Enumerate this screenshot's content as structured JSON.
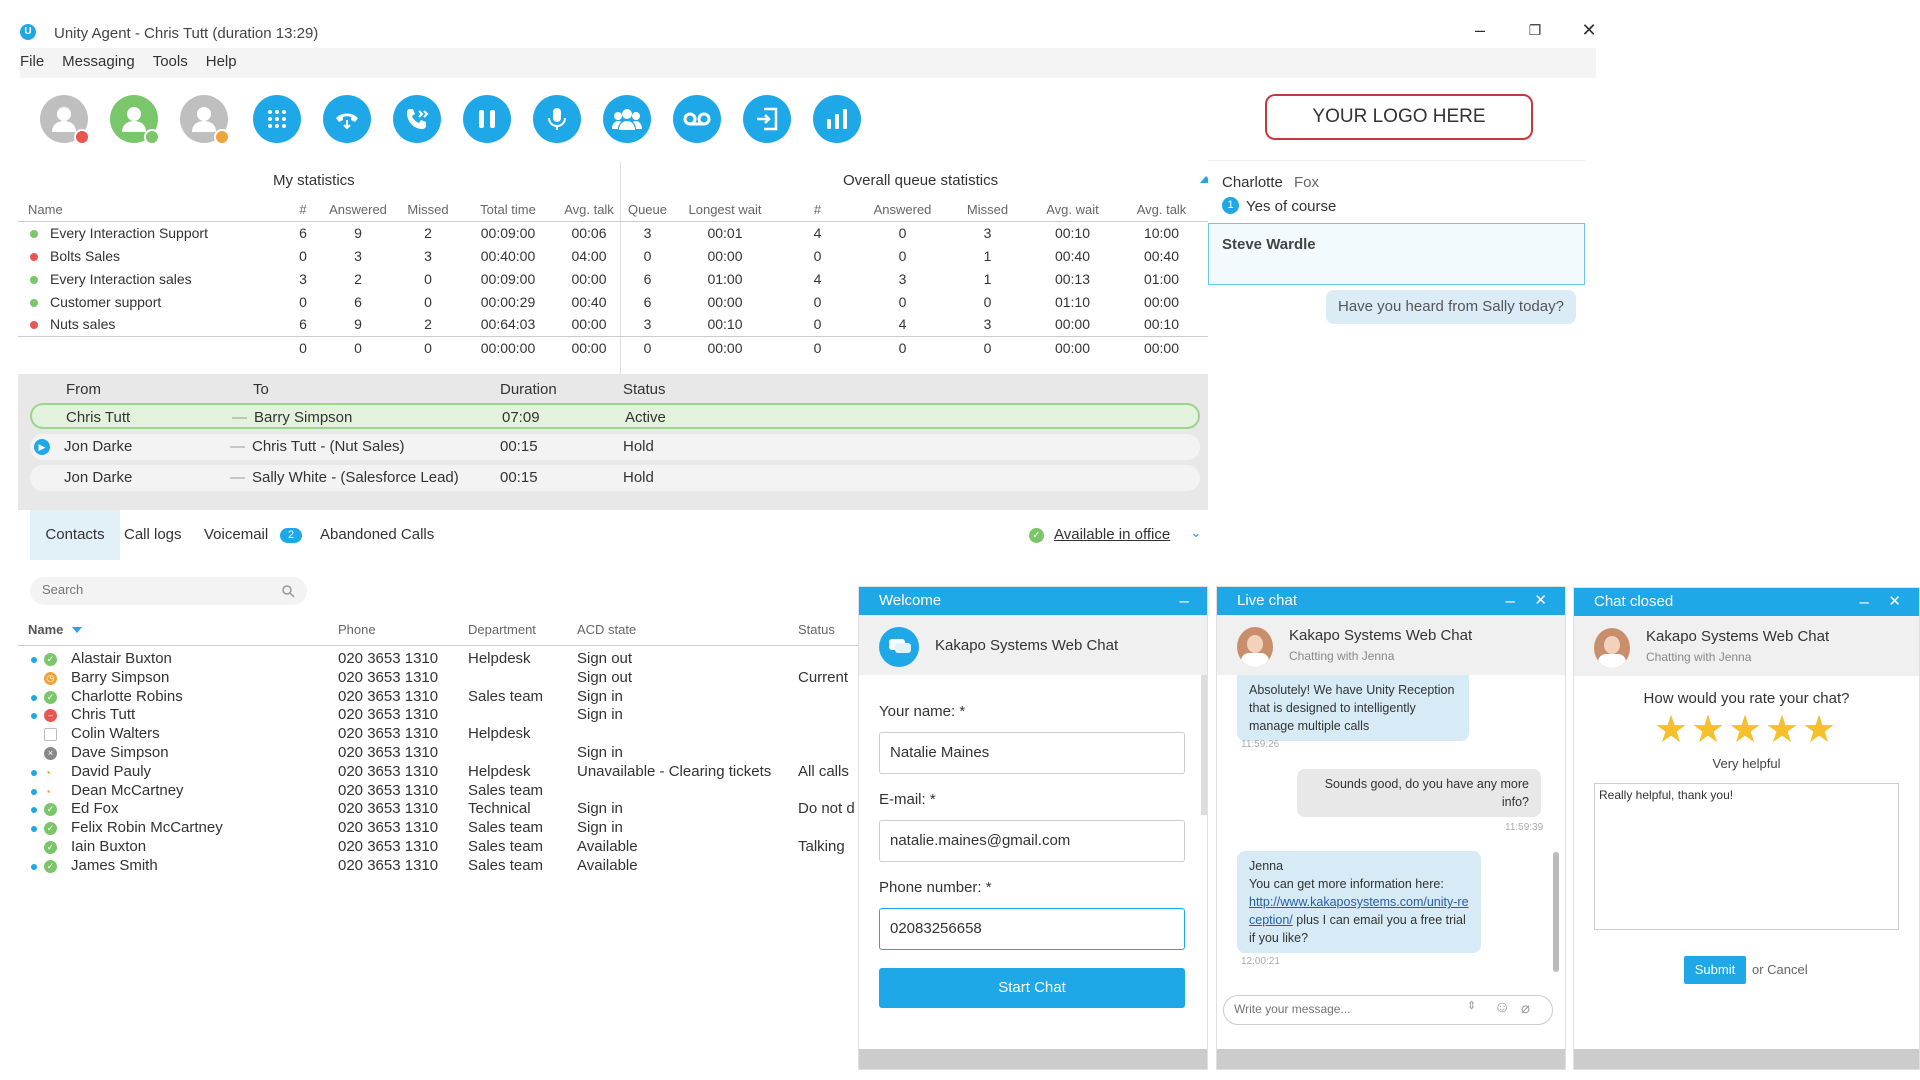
{
  "window": {
    "title": "Unity Agent - Chris Tutt  (duration 13:29)",
    "min": "–",
    "max": "❐",
    "close": "✕"
  },
  "menu": [
    "File",
    "Messaging",
    "Tools",
    "Help"
  ],
  "logo": "YOUR LOGO HERE",
  "stats": {
    "my_title": "My statistics",
    "queue_title": "Overall queue statistics",
    "headers": [
      "Name",
      "#",
      "Answered",
      "Missed",
      "Total time",
      "Avg. talk",
      "Queue",
      "Longest wait",
      "#",
      "Answered",
      "Missed",
      "Avg. wait",
      "Avg. talk"
    ],
    "rows": [
      {
        "status": "#7ac66a",
        "name": "Every Interaction Support",
        "c": [
          "6",
          "9",
          "2",
          "00:09:00",
          "00:06",
          "3",
          "00:01",
          "4",
          "0",
          "3",
          "00:10",
          "10:00"
        ]
      },
      {
        "status": "#e8564f",
        "name": "Bolts Sales",
        "c": [
          "0",
          "3",
          "3",
          "00:40:00",
          "04:00",
          "0",
          "00:00",
          "0",
          "0",
          "1",
          "00:40",
          "00:40"
        ]
      },
      {
        "status": "#7ac66a",
        "name": "Every Interaction sales",
        "c": [
          "3",
          "2",
          "0",
          "00:09:00",
          "00:00",
          "6",
          "01:00",
          "4",
          "3",
          "1",
          "00:13",
          "01:00"
        ]
      },
      {
        "status": "#7ac66a",
        "name": "Customer support",
        "c": [
          "0",
          "6",
          "0",
          "00:00:29",
          "00:40",
          "6",
          "00:00",
          "0",
          "0",
          "0",
          "01:10",
          "00:00"
        ]
      },
      {
        "status": "#e8564f",
        "name": "Nuts sales",
        "c": [
          "6",
          "9",
          "2",
          "00:64:03",
          "00:00",
          "3",
          "00:10",
          "0",
          "4",
          "3",
          "00:00",
          "00:10"
        ]
      },
      {
        "status": "",
        "name": "",
        "c": [
          "0",
          "0",
          "0",
          "00:00:00",
          "00:00",
          "0",
          "00:00",
          "0",
          "0",
          "0",
          "00:00",
          "00:00"
        ]
      }
    ]
  },
  "calls": {
    "headers": {
      "from": "From",
      "to": "To",
      "duration": "Duration",
      "status": "Status"
    },
    "rows": [
      {
        "from": "Chris Tutt",
        "sep": "—",
        "to": "Barry Simpson",
        "duration": "07:09",
        "status": "Active"
      },
      {
        "from": "Jon Darke",
        "sep": "—",
        "to": "Chris Tutt  - (Nut Sales)",
        "duration": "00:15",
        "status": "Hold"
      },
      {
        "from": "Jon Darke",
        "sep": "—",
        "to": "Sally White - (Salesforce Lead)",
        "duration": "00:15",
        "status": "Hold"
      }
    ]
  },
  "tabs": {
    "contacts": "Contacts",
    "call_logs": "Call logs",
    "voicemail": "Voicemail",
    "voicemail_badge": "2",
    "abandoned": "Abandoned Calls",
    "availability": "Available in office"
  },
  "contacts": {
    "search_placeholder": "Search",
    "headers": {
      "name": "Name",
      "phone": "Phone",
      "department": "Department",
      "acd": "ACD state",
      "status": "Status"
    },
    "rows": [
      {
        "name": "Alastair Buxton",
        "phone": "020 3653 1310",
        "dept": "Helpdesk",
        "acd": "Sign out",
        "status": "",
        "icon": "green"
      },
      {
        "name": "Barry Simpson",
        "phone": "020 3653 1310",
        "dept": "",
        "acd": "Sign out",
        "status": "Current",
        "icon": "orange"
      },
      {
        "name": "Charlotte Robins",
        "phone": "020 3653 1310",
        "dept": "Sales team",
        "acd": "Sign in",
        "status": "",
        "icon": "green"
      },
      {
        "name": "Chris Tutt",
        "phone": "020 3653 1310",
        "dept": "",
        "acd": "Sign in",
        "status": "",
        "icon": "red"
      },
      {
        "name": "Colin Walters",
        "phone": "020 3653 1310",
        "dept": "Helpdesk",
        "acd": "",
        "status": "",
        "icon": "none"
      },
      {
        "name": "Dave Simpson",
        "phone": "020 3653 1310",
        "dept": "",
        "acd": "Sign in",
        "status": "",
        "icon": "grey"
      },
      {
        "name": "David Pauly",
        "phone": "020 3653 1310",
        "dept": "Helpdesk",
        "acd": "Unavailable - Clearing tickets",
        "status": "All calls",
        "icon": "rss"
      },
      {
        "name": "Dean McCartney",
        "phone": "020 3653 1310",
        "dept": "Sales team",
        "acd": "",
        "status": "",
        "icon": "rss"
      },
      {
        "name": "Ed Fox",
        "phone": "020 3653 1310",
        "dept": "Technical",
        "acd": "Sign in",
        "status": "Do not d",
        "icon": "green"
      },
      {
        "name": "Felix Robin McCartney",
        "phone": "020 3653 1310",
        "dept": "Sales team",
        "acd": "Sign in",
        "status": "",
        "icon": "green"
      },
      {
        "name": "Iain Buxton",
        "phone": "020 3653 1310",
        "dept": "Sales team",
        "acd": "Available",
        "status": "Talking",
        "icon": "green"
      },
      {
        "name": "James Smith",
        "phone": "020 3653 1310",
        "dept": "Sales team",
        "acd": "Available",
        "status": "",
        "icon": "green"
      }
    ]
  },
  "im": {
    "contact1": "Charlotte",
    "contact1_last": " Fox",
    "contact1_badge": "1",
    "contact1_msg": "Yes of course",
    "contact2": "Steve Wardle",
    "bubble": "Have you heard from Sally today?"
  },
  "welcome": {
    "title": "Welcome",
    "min": "–",
    "brand": "Kakapo Systems Web Chat",
    "name_label": "Your name: *",
    "name_value": "Natalie Maines",
    "email_label": "E-mail: *",
    "email_value": "natalie.maines@gmail.com",
    "phone_label": "Phone number: *",
    "phone_value": "02083256658",
    "start": "Start Chat"
  },
  "live": {
    "title": "Live chat",
    "min": "–",
    "close": "✕",
    "brand": "Kakapo Systems Web Chat",
    "sub": "Chatting with Jenna",
    "m1": "Absolutely! We have Unity Reception that is designed to intelligently manage multiple calls",
    "t1": "11:59:26",
    "m2": "Sounds good, do you have any more info?",
    "t2": "11:59:39",
    "m3_name": "Jenna",
    "m3_a": "You can get more information here:",
    "m3_link": "http://www.kakaposystems.com/unity-reception/",
    "m3_b": " plus I can email you a free trial if you like?",
    "t3": "12:00:21",
    "input_placeholder": "Write your message..."
  },
  "closed": {
    "title": "Chat closed",
    "min": "–",
    "close": "✕",
    "brand": "Kakapo Systems Web Chat",
    "sub": "Chatting with Jenna",
    "question": "How would you rate your chat?",
    "rating": 5,
    "rating_label": "Very helpful",
    "feedback": "Really helpful, thank you!",
    "submit": "Submit",
    "cancel": "or Cancel"
  },
  "colors": {
    "accent": "#1fa8e8",
    "green": "#7ac66a",
    "red": "#e8564f",
    "orange": "#f0a33c",
    "star": "#f6c02a"
  }
}
